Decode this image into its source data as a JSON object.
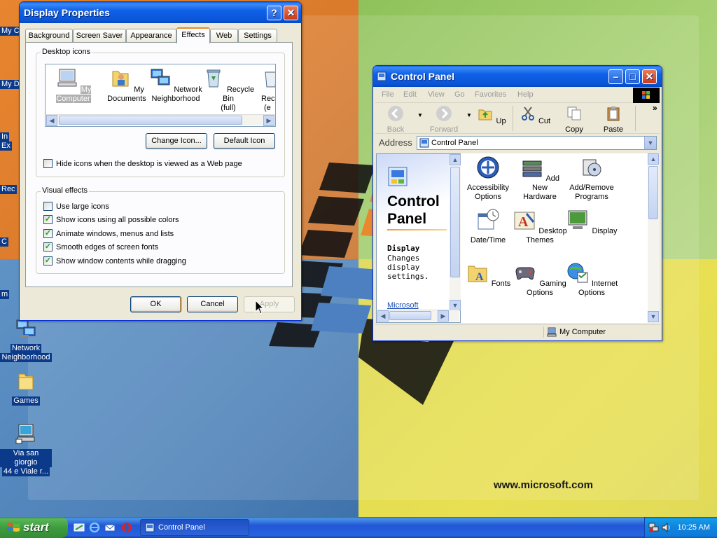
{
  "desktop": {
    "watermark": "www.microsoft.com",
    "partial_labels": [
      "My C",
      "My Do",
      "In",
      "Ex",
      "Rec",
      "C",
      "m"
    ],
    "icons": [
      {
        "label_line1": "Network",
        "label_line2": "Neighborhood",
        "icon": "network-neighborhood-icon"
      },
      {
        "label_line1": "Games",
        "label_line2": "",
        "icon": "folder-icon"
      },
      {
        "label_line1": "Via san giorgio",
        "label_line2": "44 e Viale r...",
        "icon": "computer-shortcut-icon"
      }
    ]
  },
  "display_properties": {
    "title": "Display Properties",
    "help_btn": "?",
    "close_btn": "✕",
    "tabs": [
      "Background",
      "Screen Saver",
      "Appearance",
      "Effects",
      "Web",
      "Settings"
    ],
    "active_tab": "Effects",
    "desktop_icons_group": "Desktop icons",
    "icon_items": [
      {
        "label1": "My Computer",
        "label2": "",
        "icon": "my-computer-icon",
        "selected": true
      },
      {
        "label1": "My Documents",
        "label2": "",
        "icon": "my-documents-icon",
        "selected": false
      },
      {
        "label1": "Network",
        "label2": "Neighborhood",
        "icon": "network-icon",
        "selected": false
      },
      {
        "label1": "Recycle Bin",
        "label2": "(full)",
        "icon": "recycle-bin-icon",
        "selected": false
      },
      {
        "label1": "Rec",
        "label2": "(e",
        "icon": "recycle-bin-empty-icon",
        "selected": false
      }
    ],
    "change_icon_btn": "Change Icon...",
    "default_icon_btn": "Default Icon",
    "hide_icons_label": "Hide icons when the desktop is viewed as a Web page",
    "hide_icons_checked": false,
    "visual_effects_group": "Visual effects",
    "effects": [
      {
        "label": "Use large icons",
        "checked": false
      },
      {
        "label": "Show icons using all possible colors",
        "checked": true
      },
      {
        "label": "Animate windows, menus and lists",
        "checked": true
      },
      {
        "label": "Smooth edges of screen fonts",
        "checked": true
      },
      {
        "label": "Show window contents while dragging",
        "checked": true
      }
    ],
    "ok_btn": "OK",
    "cancel_btn": "Cancel",
    "apply_btn": "Apply"
  },
  "control_panel": {
    "title": "Control Panel",
    "menu": [
      "File",
      "Edit",
      "View",
      "Go",
      "Favorites",
      "Help"
    ],
    "toolbar": [
      "Back",
      "Forward",
      "Up",
      "Cut",
      "Copy",
      "Paste"
    ],
    "toolbar_more": "»",
    "address_label": "Address",
    "address_value": "Control Panel",
    "left_title": "Control Panel",
    "selected_name": "Display",
    "selected_desc": "Changes display settings.",
    "left_link": "Microsoft",
    "items": [
      {
        "label1": "Accessibility",
        "label2": "Options",
        "icon": "accessibility-icon"
      },
      {
        "label1": "Add New",
        "label2": "Hardware",
        "icon": "add-hardware-icon"
      },
      {
        "label1": "Add/Remove",
        "label2": "Programs",
        "icon": "add-remove-programs-icon"
      },
      {
        "label1": "Date/Time",
        "label2": "",
        "icon": "date-time-icon"
      },
      {
        "label1": "Desktop",
        "label2": "Themes",
        "icon": "desktop-themes-icon"
      },
      {
        "label1": "Display",
        "label2": "",
        "icon": "display-icon"
      },
      {
        "label1": "Fonts",
        "label2": "",
        "icon": "fonts-icon"
      },
      {
        "label1": "Gaming",
        "label2": "Options",
        "icon": "gaming-options-icon"
      },
      {
        "label1": "Internet",
        "label2": "Options",
        "icon": "internet-options-icon"
      }
    ],
    "status_text": "My Computer"
  },
  "taskbar": {
    "start_label": "start",
    "task_label": "Control Panel",
    "clock": "10:25 AM"
  },
  "colors": {
    "xp_blue": "#0a54d6",
    "start_green": "#3f9c3f",
    "tab_active_accent": "#e68b2c"
  }
}
